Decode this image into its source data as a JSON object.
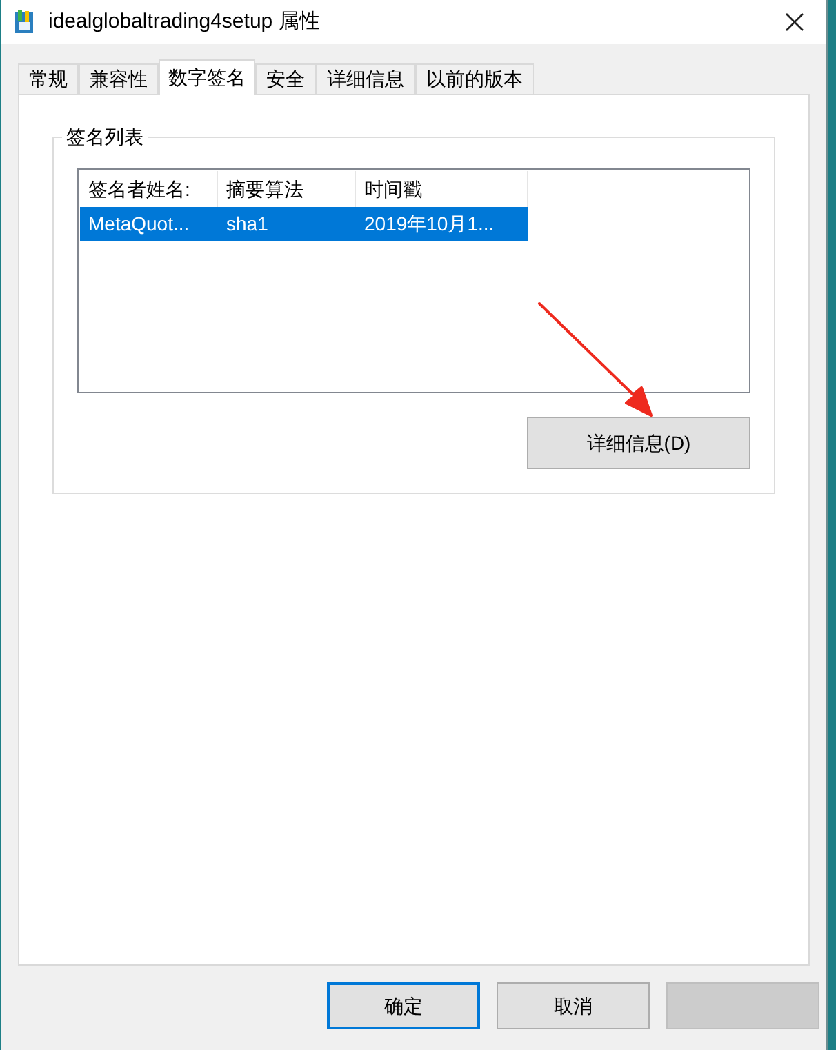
{
  "window": {
    "title": "idealglobaltrading4setup 属性"
  },
  "tabs": [
    {
      "label": "常规",
      "selected": false
    },
    {
      "label": "兼容性",
      "selected": false
    },
    {
      "label": "数字签名",
      "selected": true
    },
    {
      "label": "安全",
      "selected": false
    },
    {
      "label": "详细信息",
      "selected": false
    },
    {
      "label": "以前的版本",
      "selected": false
    }
  ],
  "signature_group": {
    "title": "签名列表",
    "columns": [
      "签名者姓名:",
      "摘要算法",
      "时间戳"
    ],
    "rows": [
      {
        "cells": [
          "MetaQuot...",
          "sha1",
          "2019年10月1..."
        ],
        "selected": true
      }
    ],
    "details_button": "详细信息(D)"
  },
  "buttons": [
    {
      "label": "确定",
      "default": true,
      "disabled": false
    },
    {
      "label": "取消",
      "default": false,
      "disabled": false
    },
    {
      "disabled": true,
      "default": false
    }
  ]
}
